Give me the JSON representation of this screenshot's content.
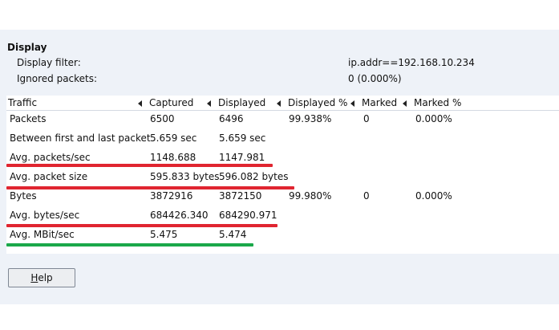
{
  "display": {
    "title": "Display",
    "filter_label": "Display filter:",
    "filter_value": "ip.addr==192.168.10.234",
    "ignored_label": "Ignored packets:",
    "ignored_value": "0 (0.000%)"
  },
  "table": {
    "columns": [
      "Traffic",
      "Captured",
      "Displayed",
      "Displayed %",
      "Marked",
      "Marked %"
    ],
    "rows": [
      {
        "traffic": "Packets",
        "captured": "6500",
        "displayed": "6496",
        "displayed_pct": "99.938%",
        "marked": "0",
        "marked_pct": "0.000%"
      },
      {
        "traffic": "Between first and last packet",
        "captured": "5.659 sec",
        "displayed": "5.659 sec",
        "displayed_pct": "",
        "marked": "",
        "marked_pct": ""
      },
      {
        "traffic": "Avg. packets/sec",
        "captured": "1148.688",
        "displayed": "1147.981",
        "displayed_pct": "",
        "marked": "",
        "marked_pct": ""
      },
      {
        "traffic": "Avg. packet size",
        "captured": "595.833 bytes",
        "displayed": "596.082 bytes",
        "displayed_pct": "",
        "marked": "",
        "marked_pct": ""
      },
      {
        "traffic": "Bytes",
        "captured": "3872916",
        "displayed": "3872150",
        "displayed_pct": "99.980%",
        "marked": "0",
        "marked_pct": "0.000%"
      },
      {
        "traffic": "Avg. bytes/sec",
        "captured": "684426.340",
        "displayed": "684290.971",
        "displayed_pct": "",
        "marked": "",
        "marked_pct": ""
      },
      {
        "traffic": "Avg. MBit/sec",
        "captured": "5.475",
        "displayed": "5.474",
        "displayed_pct": "",
        "marked": "",
        "marked_pct": ""
      }
    ]
  },
  "highlight_colors": {
    "red": "#e02530",
    "green": "#1aa84a"
  },
  "buttons": {
    "help_mnemonic": "H",
    "help_rest": "elp"
  }
}
